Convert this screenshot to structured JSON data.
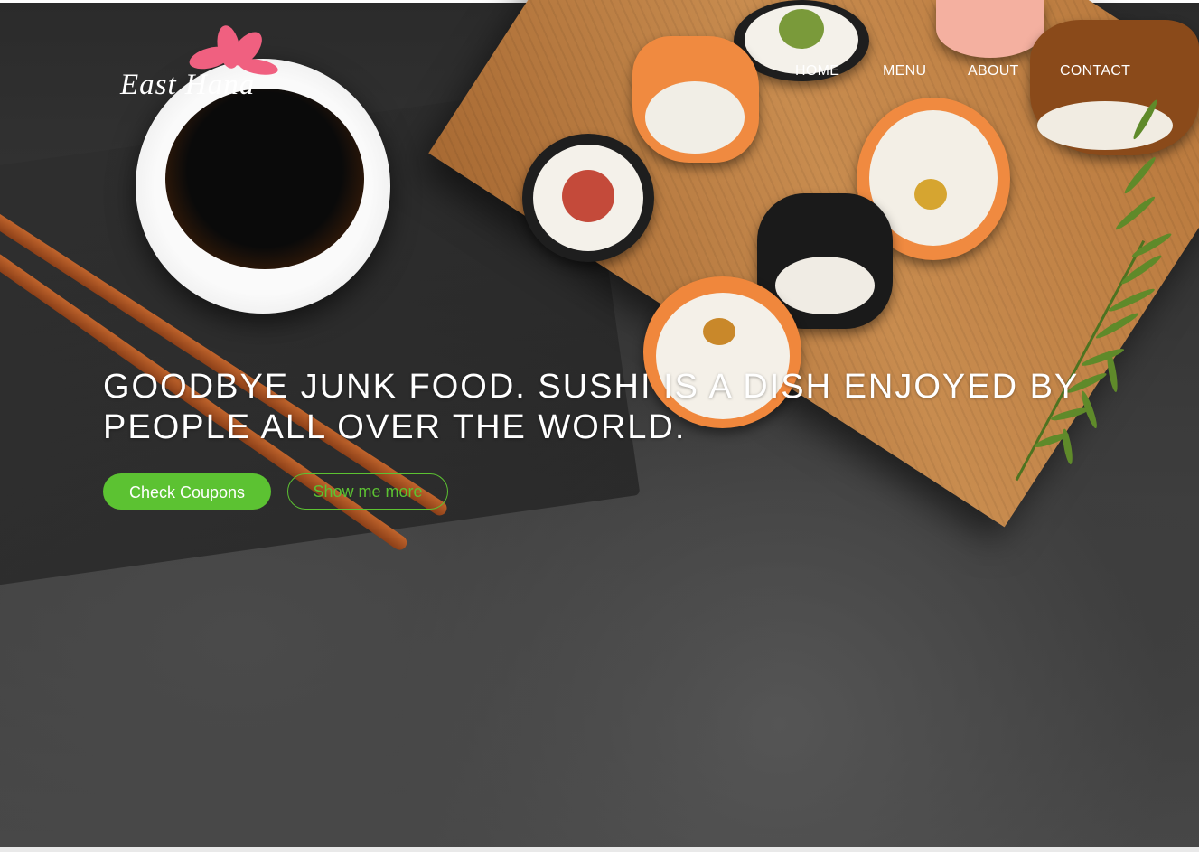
{
  "brand": {
    "name": "East Hana",
    "flower_color": "#f06080",
    "flower_icon": "sakura-flower-icon"
  },
  "nav": {
    "items": [
      {
        "label": "HOME"
      },
      {
        "label": "MENU"
      },
      {
        "label": "ABOUT"
      },
      {
        "label": "CONTACT"
      }
    ]
  },
  "hero": {
    "headline": "GOODBYE JUNK FOOD. SUSHI IS A DISH ENJOYED BY PEOPLE ALL OVER THE WORLD.",
    "primary_button": "Check Coupons",
    "secondary_button": "Show me more"
  },
  "colors": {
    "accent": "#5cc232",
    "nav_text": "#ffffff",
    "background": "#3a3a3a"
  }
}
